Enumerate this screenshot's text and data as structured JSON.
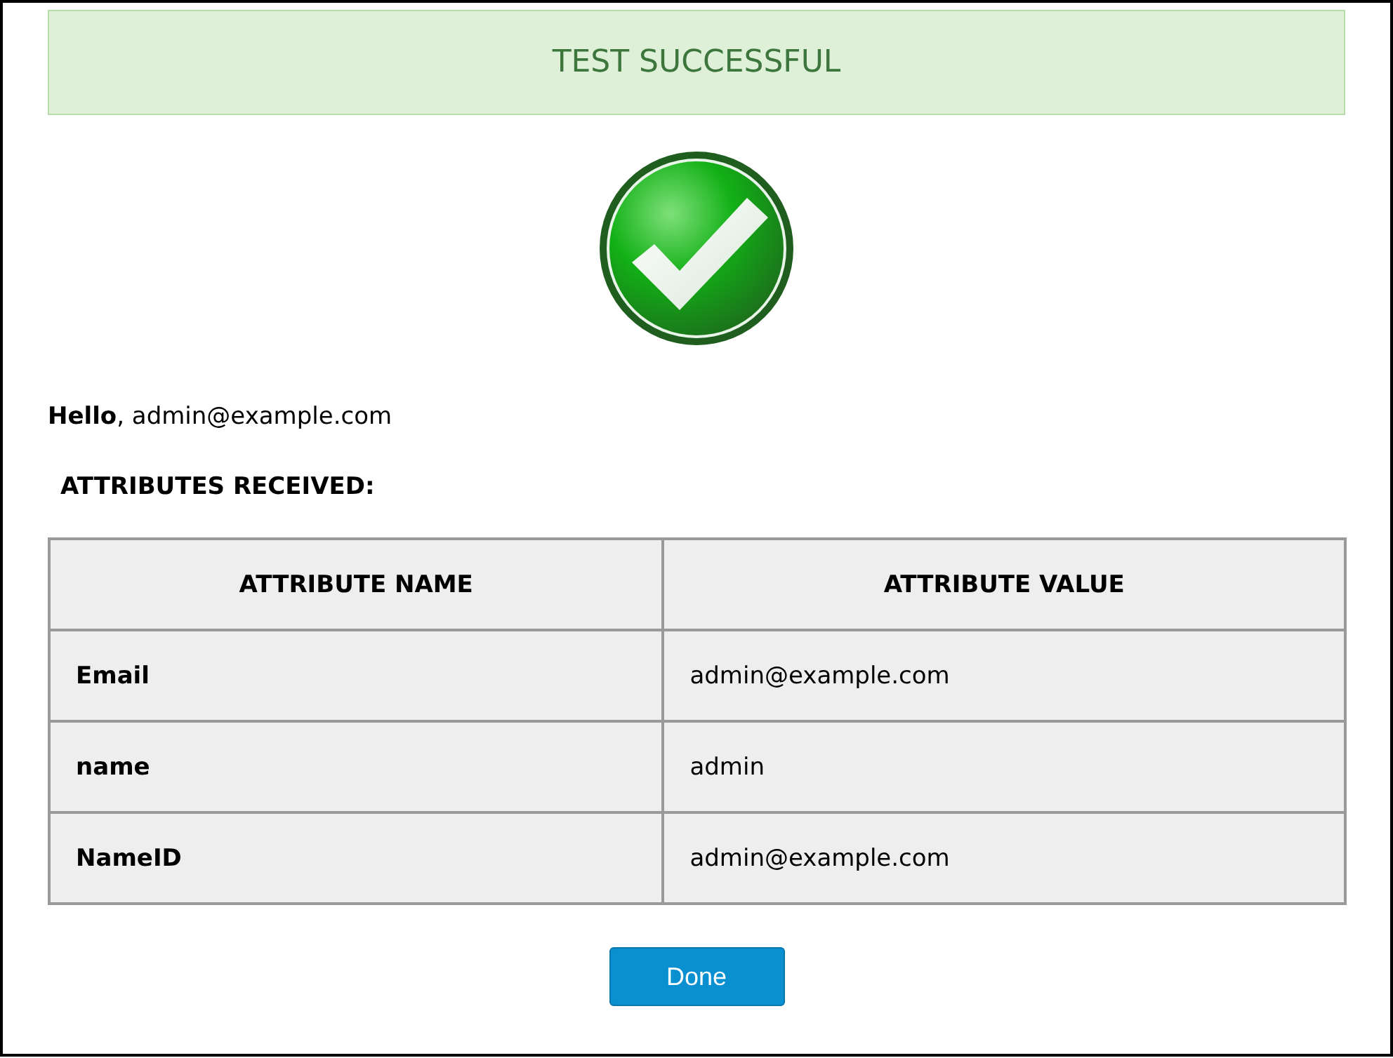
{
  "banner": {
    "text": "TEST SUCCESSFUL"
  },
  "greeting": "**Hello**, admin@example.com",
  "attributes_heading": "ATTRIBUTES RECEIVED:",
  "table": {
    "columns": [
      "ATTRIBUTE NAME",
      "ATTRIBUTE VALUE"
    ],
    "rows": [
      {
        "name": "Email",
        "value": "admin@example.com"
      },
      {
        "name": "name",
        "value": "admin"
      },
      {
        "name": "NameID",
        "value": "admin@example.com"
      }
    ]
  },
  "buttons": [
    "Done"
  ]
}
